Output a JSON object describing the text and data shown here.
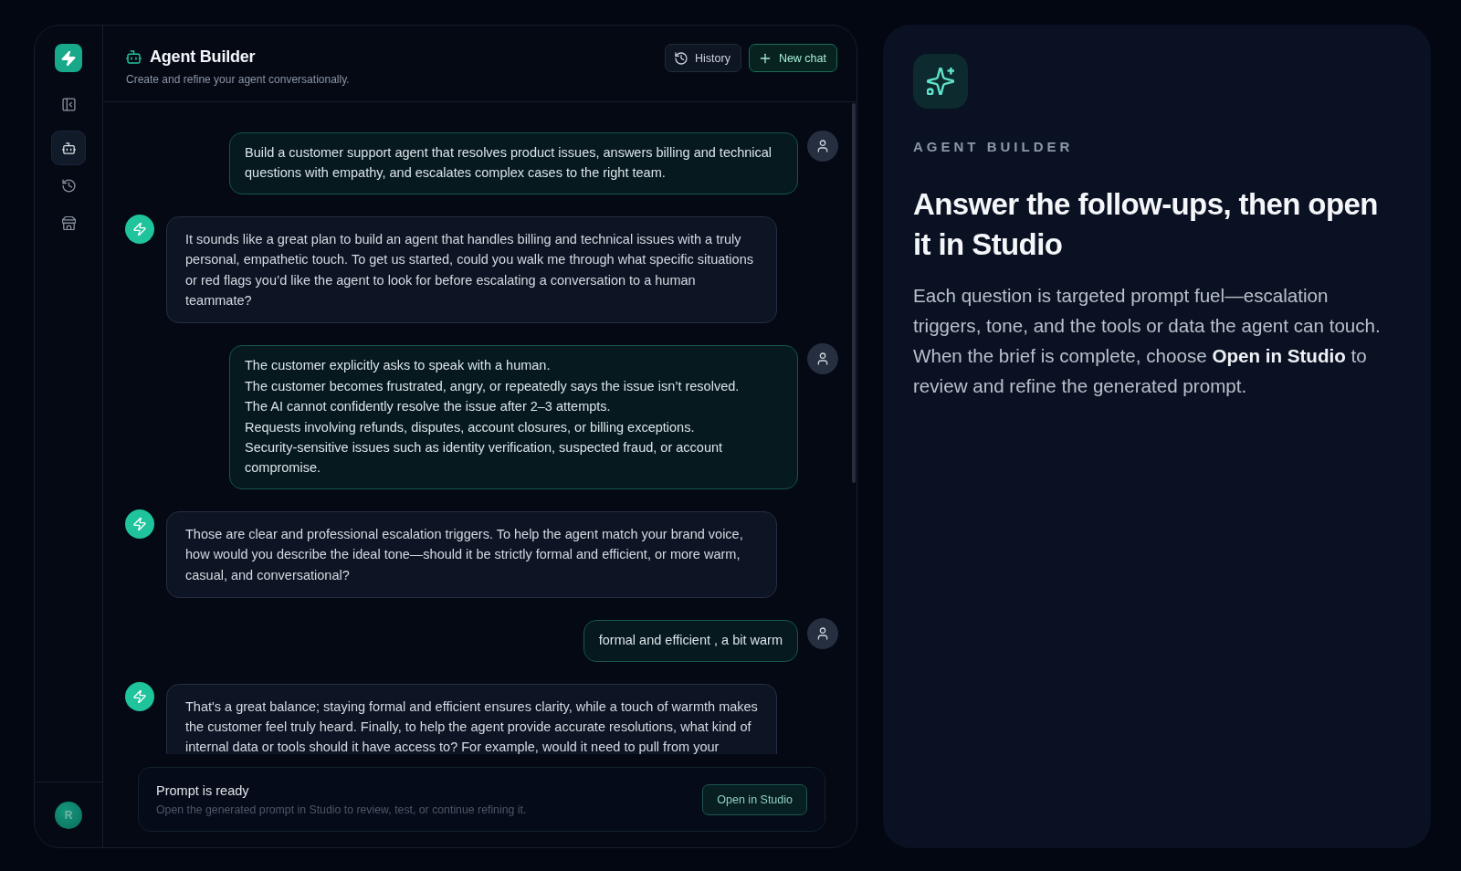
{
  "sidebar": {
    "nav": [
      {
        "kind": "agent",
        "selected": true
      },
      {
        "kind": "history",
        "selected": false
      },
      {
        "kind": "store",
        "selected": false
      }
    ],
    "avatar": "R"
  },
  "header": {
    "title": "Agent Builder",
    "subtitle": "Create and refine your agent conversationally.",
    "buttons": [
      {
        "kind": "history",
        "label": "History"
      },
      {
        "kind": "new",
        "label": "New chat"
      }
    ]
  },
  "messages": [
    {
      "kind": "user",
      "text": "Build a customer support agent that resolves product issues, answers billing and technical questions with empathy, and escalates complex cases to the right team."
    },
    {
      "kind": "assistant",
      "text": "It sounds like a great plan to build an agent that handles billing and technical issues with a truly personal, empathetic touch. To get us started, could you walk me through what specific situations or red flags you’d like the agent to look for before escalating a conversation to a human teammate?"
    },
    {
      "kind": "user",
      "text": "The customer explicitly asks to speak with a human.\nThe customer becomes frustrated, angry, or repeatedly says the issue isn’t resolved.\nThe AI cannot confidently resolve the issue after 2–3 attempts.\nRequests involving refunds, disputes, account closures, or billing exceptions.\nSecurity-sensitive issues such as identity verification, suspected fraud, or account compromise."
    },
    {
      "kind": "assistant",
      "text": "Those are clear and professional escalation triggers. To help the agent match your brand voice, how would you describe the ideal tone—should it be strictly formal and efficient, or more warm, casual, and conversational?"
    },
    {
      "kind": "user",
      "text": "formal and efficient , a bit warm"
    },
    {
      "kind": "assistant",
      "text": "That's a great balance; staying formal and efficient ensures clarity, while a touch of warmth makes the customer feel truly heard. Finally, to help the agent provide accurate resolutions, what kind of internal data or tools should it have access to? For example, would it need to pull from your"
    }
  ],
  "prompt_card": {
    "title": "Prompt is ready",
    "description": "Open the generated prompt in Studio to review, test, or continue refining it.",
    "button": "Open in Studio"
  },
  "info_panel": {
    "eyebrow": "AGENT BUILDER",
    "heading": "Answer the follow-ups, then open it in Studio",
    "body": "Each question is targeted prompt fuel—escalation triggers, tone, and the tools or data the agent can touch. When the brief is complete, choose **Open in Studio** to review and refine the generated prompt."
  }
}
